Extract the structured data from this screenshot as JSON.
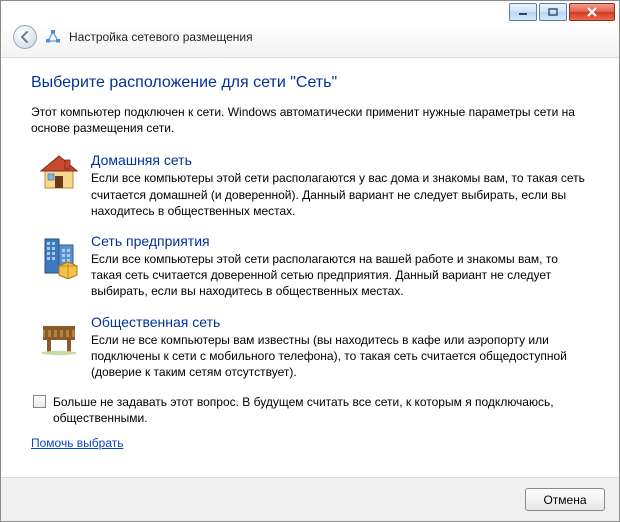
{
  "window": {
    "title": "Настройка сетевого размещения"
  },
  "heading": "Выберите расположение для сети \"Сеть\"",
  "intro": "Этот компьютер подключен к сети. Windows автоматически применит нужные параметры сети на основе размещения сети.",
  "options": [
    {
      "icon": "home",
      "title": "Домашняя сеть",
      "desc": "Если все компьютеры этой сети располагаются у вас дома и знакомы вам, то такая сеть считается домашней (и доверенной). Данный вариант не следует выбирать, если вы находитесь в общественных местах."
    },
    {
      "icon": "work",
      "title": "Сеть предприятия",
      "desc": "Если все компьютеры этой сети располагаются на вашей работе и знакомы вам, то такая сеть считается доверенной сетью предприятия. Данный вариант не следует выбирать, если вы находитесь в общественных местах."
    },
    {
      "icon": "public",
      "title": "Общественная сеть",
      "desc": "Если не все компьютеры вам известны (вы находитесь в кафе или аэропорту или подключены к сети с мобильного телефона), то такая сеть считается общедоступной (доверие к таким сетям отсутствует)."
    }
  ],
  "checkbox_label": "Больше не задавать этот вопрос. В будущем считать все сети, к которым я подключаюсь, общественными.",
  "help_link": "Помочь выбрать",
  "buttons": {
    "cancel": "Отмена"
  }
}
